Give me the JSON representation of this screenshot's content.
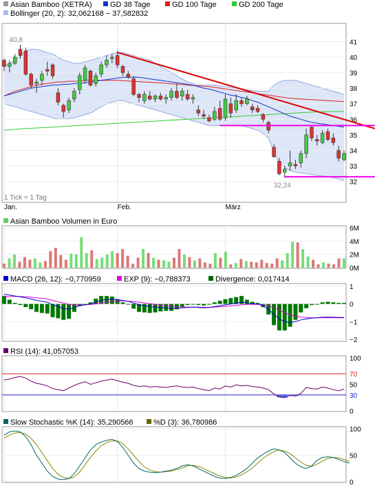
{
  "chart_data": [
    {
      "type": "candlestick",
      "panel": "price",
      "legend": [
        {
          "label": "Asian Bamboo (XETRA)",
          "color": "#999999"
        },
        {
          "label": "GD 38 Tage",
          "color": "#1133cc"
        },
        {
          "label": "GD 100 Tage",
          "color": "#dd2222"
        },
        {
          "label": "GD 200 Tage",
          "color": "#33cc33"
        },
        {
          "label": "Bollinger (20, 2): 32,062168 − 37,582832",
          "color": "#7799dd"
        }
      ],
      "ylim": [
        31.5,
        41.9
      ],
      "y_ticks": [
        "41",
        "40",
        "39",
        "38",
        "37",
        "36",
        "35",
        "34",
        "33",
        "32"
      ],
      "x_ticks": [
        {
          "label": "Jan.",
          "index": 0
        },
        {
          "label": "Feb.",
          "index": 21
        },
        {
          "label": "März",
          "index": 41
        }
      ],
      "footnote": "1 Tick = 1 Tag",
      "annotations": [
        {
          "label": "40,8",
          "index": 3,
          "value": 40.8
        },
        {
          "label": "32,24",
          "index": 52,
          "value": 32.24
        }
      ],
      "candles": [
        [
          39.8,
          39.9,
          39.1,
          39.4
        ],
        [
          39.4,
          39.8,
          39.0,
          39.6
        ],
        [
          39.6,
          40.2,
          39.5,
          40.0
        ],
        [
          40.5,
          40.8,
          39.9,
          40.1
        ],
        [
          40.4,
          40.6,
          38.8,
          38.9
        ],
        [
          38.9,
          39.0,
          38.0,
          38.2
        ],
        [
          38.3,
          38.6,
          37.7,
          38.4
        ],
        [
          38.5,
          39.1,
          38.2,
          38.9
        ],
        [
          39.2,
          39.7,
          38.8,
          39.1
        ],
        [
          39.5,
          39.6,
          38.6,
          38.8
        ],
        [
          37.7,
          38.0,
          36.9,
          37.1
        ],
        [
          36.9,
          37.0,
          36.1,
          36.5
        ],
        [
          36.6,
          37.4,
          36.4,
          37.2
        ],
        [
          37.3,
          38.0,
          37.1,
          37.8
        ],
        [
          37.9,
          39.0,
          37.6,
          38.8
        ],
        [
          38.5,
          39.5,
          38.3,
          39.3
        ],
        [
          39.1,
          39.2,
          38.1,
          38.2
        ],
        [
          38.3,
          39.0,
          38.1,
          38.8
        ],
        [
          38.9,
          39.7,
          38.7,
          39.5
        ],
        [
          39.5,
          40.1,
          39.3,
          39.8
        ],
        [
          39.9,
          40.2,
          39.6,
          40.0
        ],
        [
          40.1,
          40.4,
          39.3,
          39.5
        ],
        [
          39.4,
          39.5,
          38.8,
          39.0
        ],
        [
          38.9,
          39.1,
          38.6,
          38.7
        ],
        [
          38.6,
          38.8,
          37.5,
          37.6
        ],
        [
          37.6,
          37.7,
          37.1,
          37.4
        ],
        [
          37.2,
          37.8,
          37.0,
          37.6
        ],
        [
          37.5,
          37.8,
          37.2,
          37.3
        ],
        [
          37.3,
          37.6,
          37.1,
          37.5
        ],
        [
          37.5,
          37.7,
          37.2,
          37.3
        ],
        [
          37.3,
          37.6,
          37.0,
          37.4
        ],
        [
          37.4,
          38.0,
          37.2,
          37.8
        ],
        [
          37.8,
          38.3,
          37.3,
          37.4
        ],
        [
          37.5,
          38.0,
          37.2,
          37.8
        ],
        [
          37.6,
          37.9,
          37.2,
          37.3
        ],
        [
          37.3,
          37.6,
          37.0,
          37.4
        ],
        [
          36.6,
          36.9,
          36.2,
          36.4
        ],
        [
          36.3,
          36.6,
          36.0,
          36.2
        ],
        [
          36.1,
          36.3,
          35.8,
          35.9
        ],
        [
          36.0,
          36.8,
          35.9,
          36.5
        ],
        [
          36.7,
          37.2,
          35.9,
          36.0
        ],
        [
          36.1,
          37.6,
          35.9,
          37.3
        ],
        [
          37.0,
          37.4,
          36.1,
          36.4
        ],
        [
          36.6,
          37.6,
          36.4,
          37.2
        ],
        [
          37.2,
          37.4,
          36.8,
          37.0
        ],
        [
          37.0,
          37.5,
          36.9,
          37.3
        ],
        [
          36.8,
          37.0,
          36.4,
          36.6
        ],
        [
          36.7,
          36.9,
          36.4,
          36.5
        ],
        [
          36.3,
          36.4,
          35.8,
          36.0
        ],
        [
          35.8,
          35.9,
          35.1,
          35.3
        ],
        [
          34.2,
          34.4,
          33.5,
          33.6
        ],
        [
          33.3,
          33.5,
          32.4,
          32.5
        ],
        [
          32.6,
          33.0,
          32.24,
          32.8
        ],
        [
          33.0,
          34.0,
          32.7,
          33.2
        ],
        [
          33.1,
          33.4,
          32.8,
          33.0
        ],
        [
          33.2,
          34.0,
          32.9,
          33.8
        ],
        [
          33.8,
          35.4,
          33.5,
          35.0
        ],
        [
          35.5,
          35.6,
          34.6,
          34.8
        ],
        [
          34.7,
          35.0,
          34.3,
          34.6
        ],
        [
          34.5,
          35.3,
          34.4,
          35.1
        ],
        [
          35.2,
          35.4,
          34.6,
          34.7
        ],
        [
          34.8,
          35.1,
          34.3,
          34.5
        ],
        [
          34.0,
          34.3,
          33.3,
          33.5
        ],
        [
          33.4,
          34.0,
          33.3,
          33.8
        ]
      ],
      "ma38": [
        37.5,
        37.6,
        37.7,
        37.8,
        37.9,
        38.0,
        38.05,
        38.1,
        38.15,
        38.2,
        38.2,
        38.25,
        38.25,
        38.3,
        38.3,
        38.35,
        38.4,
        38.45,
        38.5,
        38.55,
        38.6,
        38.65,
        38.7,
        38.7,
        38.7,
        38.7,
        38.65,
        38.6,
        38.55,
        38.5,
        38.45,
        38.4,
        38.35,
        38.3,
        38.25,
        38.2,
        38.1,
        38.0,
        37.95,
        37.85,
        37.75,
        37.65,
        37.55,
        37.5,
        37.4,
        37.35,
        37.2,
        37.1,
        36.95,
        36.8,
        36.65,
        36.5,
        36.35,
        36.2,
        36.1,
        36.0,
        35.9,
        35.8,
        35.75,
        35.7,
        35.65,
        35.6,
        35.55,
        35.5
      ],
      "ma100": [
        37.5,
        37.65,
        37.8,
        37.9,
        38.0,
        38.1,
        38.2,
        38.25,
        38.3,
        38.35,
        38.4,
        38.4,
        38.45,
        38.45,
        38.45,
        38.5,
        38.5,
        38.5,
        38.5,
        38.5,
        38.5,
        38.5,
        38.48,
        38.46,
        38.44,
        38.42,
        38.4,
        38.38,
        38.36,
        38.34,
        38.3,
        38.28,
        38.26,
        38.24,
        38.2,
        38.18,
        38.15,
        38.12,
        38.1,
        38.05,
        38.0,
        37.95,
        37.9,
        37.85,
        37.8,
        37.75,
        37.7,
        37.65,
        37.6,
        37.55,
        37.5,
        37.45,
        37.4,
        37.35,
        37.33,
        37.3,
        37.28,
        37.26,
        37.24,
        37.22,
        37.2,
        37.18,
        37.16,
        37.14
      ],
      "ma200": [
        35.3,
        35.32,
        35.35,
        35.38,
        35.4,
        35.42,
        35.44,
        35.46,
        35.48,
        35.5,
        35.52,
        35.54,
        35.56,
        35.58,
        35.6,
        35.62,
        35.64,
        35.66,
        35.68,
        35.7,
        35.72,
        35.74,
        35.76,
        35.78,
        35.8,
        35.82,
        35.84,
        35.86,
        35.88,
        35.9,
        35.92,
        35.94,
        35.96,
        35.98,
        36.0,
        36.02,
        36.04,
        36.06,
        36.08,
        36.1,
        36.12,
        36.14,
        36.16,
        36.18,
        36.2,
        36.22,
        36.24,
        36.26,
        36.28,
        36.3,
        36.32,
        36.34,
        36.36,
        36.38,
        36.4,
        36.42,
        36.44,
        36.46,
        36.47,
        36.48,
        36.49,
        36.5,
        36.5,
        36.5
      ],
      "boll_upper": [
        39.4,
        39.6,
        39.8,
        40.1,
        40.4,
        40.5,
        40.5,
        40.4,
        40.3,
        40.2,
        40.0,
        39.8,
        39.7,
        39.6,
        39.6,
        39.7,
        39.8,
        39.9,
        40.0,
        40.1,
        40.2,
        40.3,
        40.3,
        40.2,
        40.1,
        40.0,
        39.9,
        39.8,
        39.6,
        39.4,
        39.2,
        39.0,
        38.8,
        38.6,
        38.4,
        38.3,
        38.2,
        38.2,
        38.2,
        38.2,
        38.15,
        38.1,
        38.05,
        38.0,
        37.95,
        37.9,
        37.85,
        37.8,
        37.8,
        37.8,
        38.2,
        38.4,
        38.5,
        38.5,
        38.5,
        38.4,
        38.3,
        38.2,
        38.1,
        38.0,
        37.9,
        37.8,
        37.7,
        37.6
      ],
      "boll_lower": [
        37.0,
        36.9,
        36.8,
        36.7,
        36.6,
        36.5,
        36.4,
        36.3,
        36.2,
        36.1,
        36.0,
        36.0,
        36.05,
        36.1,
        36.2,
        36.3,
        36.4,
        36.6,
        36.8,
        37.0,
        37.1,
        37.2,
        37.2,
        37.1,
        37.0,
        36.9,
        36.8,
        36.7,
        36.6,
        36.5,
        36.4,
        36.3,
        36.2,
        36.1,
        36.0,
        35.9,
        35.8,
        35.7,
        35.6,
        35.6,
        35.6,
        35.6,
        35.6,
        35.6,
        35.6,
        35.5,
        35.4,
        35.3,
        35.1,
        34.8,
        33.9,
        33.2,
        32.9,
        32.7,
        32.6,
        32.55,
        32.5,
        32.45,
        32.4,
        32.35,
        32.3,
        32.25,
        32.15,
        32.06
      ],
      "trendlines": [
        {
          "color": "#dd0000",
          "from": [
            21,
            40.3
          ],
          "to": [
            70,
            35.4
          ]
        },
        {
          "color": "#ee00ee",
          "from": [
            40,
            35.6
          ],
          "to": [
            70,
            35.6
          ]
        },
        {
          "color": "#ee00ee",
          "from": [
            52,
            32.3
          ],
          "to": [
            70,
            32.3
          ]
        }
      ]
    },
    {
      "type": "bar",
      "panel": "volume",
      "title": "Asian Bamboo Volumen in Euro",
      "y_ticks": [
        "6M",
        "4M",
        "2M",
        "0M"
      ],
      "ylim": [
        0,
        6
      ],
      "values": [
        0.6,
        1.4,
        2.0,
        0.9,
        1.6,
        1.2,
        1.4,
        0.8,
        1.0,
        2.5,
        3.0,
        1.9,
        1.2,
        2.1,
        2.0,
        4.6,
        2.2,
        2.6,
        1.3,
        1.5,
        2.0,
        2.5,
        2.2,
        2.8,
        1.8,
        0.6,
        1.5,
        2.8,
        2.2,
        1.5,
        1.2,
        1.1,
        0.9,
        1.5,
        2.8,
        2.0,
        1.6,
        1.1,
        1.4,
        0.8,
        0.6,
        2.2,
        1.5,
        2.4,
        0.5,
        0.7,
        1.3,
        1.0,
        0.9,
        0.8,
        1.2,
        0.7,
        0.6,
        1.4,
        1.1,
        2.2,
        3.9,
        3.8,
        2.8,
        1.7,
        1.2,
        0.5,
        0.8,
        0.6,
        0.5,
        1.4,
        1.4
      ]
    },
    {
      "type": "line",
      "panel": "macd",
      "legend": [
        {
          "label": "MACD (26, 12): −0,770959",
          "color": "#0000cc"
        },
        {
          "label": "EXP (9): −0,788373",
          "color": "#dd00dd"
        },
        {
          "label": "Divergence: 0,017414",
          "color": "#006600"
        }
      ],
      "y_ticks": [
        "1",
        "0",
        "−1",
        "−2"
      ],
      "ylim": [
        -2,
        1
      ],
      "macd": [
        0.55,
        0.5,
        0.45,
        0.4,
        0.35,
        0.28,
        0.2,
        0.15,
        0.1,
        -0.05,
        -0.15,
        -0.25,
        -0.3,
        -0.2,
        -0.1,
        -0.05,
        0.0,
        0.1,
        0.2,
        0.25,
        0.28,
        0.25,
        0.2,
        0.15,
        0.05,
        -0.05,
        -0.1,
        -0.15,
        -0.18,
        -0.2,
        -0.22,
        -0.25,
        -0.25,
        -0.22,
        -0.2,
        -0.18,
        -0.2,
        -0.22,
        -0.2,
        -0.15,
        -0.1,
        -0.05,
        0.0,
        0.05,
        0.1,
        0.05,
        0.02,
        0.0,
        -0.1,
        -0.3,
        -0.6,
        -0.85,
        -1.0,
        -1.05,
        -1.0,
        -0.9,
        -0.85,
        -0.8,
        -0.78,
        -0.75,
        -0.74,
        -0.75,
        -0.76,
        -0.77
      ],
      "signal": [
        0.4,
        0.42,
        0.43,
        0.42,
        0.41,
        0.38,
        0.35,
        0.32,
        0.28,
        0.2,
        0.12,
        0.05,
        -0.02,
        -0.05,
        -0.06,
        -0.05,
        -0.03,
        0.0,
        0.05,
        0.1,
        0.14,
        0.16,
        0.17,
        0.16,
        0.14,
        0.1,
        0.06,
        0.02,
        -0.02,
        -0.06,
        -0.09,
        -0.12,
        -0.15,
        -0.17,
        -0.18,
        -0.18,
        -0.18,
        -0.19,
        -0.19,
        -0.18,
        -0.16,
        -0.14,
        -0.11,
        -0.08,
        -0.05,
        -0.03,
        -0.02,
        -0.02,
        -0.04,
        -0.1,
        -0.2,
        -0.35,
        -0.5,
        -0.62,
        -0.7,
        -0.74,
        -0.77,
        -0.78,
        -0.78,
        -0.78,
        -0.78,
        -0.78,
        -0.78,
        -0.79
      ]
    },
    {
      "type": "line",
      "panel": "rsi",
      "legend": [
        {
          "label": "RSI (14): 41,057053",
          "color": "#660066"
        }
      ],
      "y_ticks": [
        "100",
        "70",
        "50",
        "30",
        "0"
      ],
      "ylim": [
        0,
        100
      ],
      "reference_lines": [
        {
          "value": 70,
          "color": "#dd2222"
        },
        {
          "value": 30,
          "color": "#2222cc"
        }
      ],
      "values": [
        58,
        60,
        63,
        65,
        62,
        56,
        52,
        50,
        47,
        42,
        40,
        38,
        43,
        48,
        52,
        55,
        50,
        53,
        56,
        58,
        60,
        57,
        54,
        52,
        48,
        46,
        47,
        45,
        46,
        45,
        44,
        46,
        47,
        45,
        44,
        45,
        42,
        40,
        38,
        43,
        41,
        47,
        45,
        49,
        47,
        48,
        46,
        45,
        43,
        40,
        32,
        26,
        25,
        29,
        28,
        33,
        44,
        42,
        41,
        45,
        43,
        40,
        38,
        41
      ]
    },
    {
      "type": "line",
      "panel": "stochastic",
      "legend": [
        {
          "label": "Slow Stochastic %K (14): 35,290566",
          "color": "#006666"
        },
        {
          "label": "%D (3): 36,780986",
          "color": "#666600"
        }
      ],
      "y_ticks": [
        "100",
        "50",
        "0"
      ],
      "ylim": [
        0,
        100
      ],
      "k": [
        88,
        94,
        96,
        94,
        85,
        70,
        50,
        35,
        20,
        10,
        5,
        4,
        6,
        15,
        30,
        45,
        60,
        70,
        75,
        78,
        80,
        76,
        65,
        50,
        35,
        25,
        20,
        18,
        17,
        18,
        20,
        22,
        25,
        30,
        32,
        30,
        25,
        20,
        15,
        10,
        7,
        6,
        8,
        12,
        18,
        25,
        35,
        45,
        52,
        58,
        62,
        60,
        55,
        45,
        35,
        28,
        25,
        30,
        40,
        46,
        47,
        46,
        42,
        38,
        35
      ],
      "d": [
        82,
        88,
        92,
        93,
        90,
        82,
        70,
        55,
        40,
        25,
        14,
        8,
        6,
        9,
        18,
        32,
        46,
        58,
        68,
        74,
        77,
        77,
        72,
        62,
        50,
        38,
        28,
        22,
        19,
        18,
        19,
        20,
        23,
        26,
        30,
        31,
        29,
        25,
        20,
        15,
        11,
        8,
        7,
        9,
        13,
        19,
        26,
        35,
        44,
        51,
        57,
        60,
        58,
        53,
        45,
        37,
        31,
        29,
        33,
        39,
        44,
        46,
        45,
        42,
        38
      ]
    }
  ]
}
